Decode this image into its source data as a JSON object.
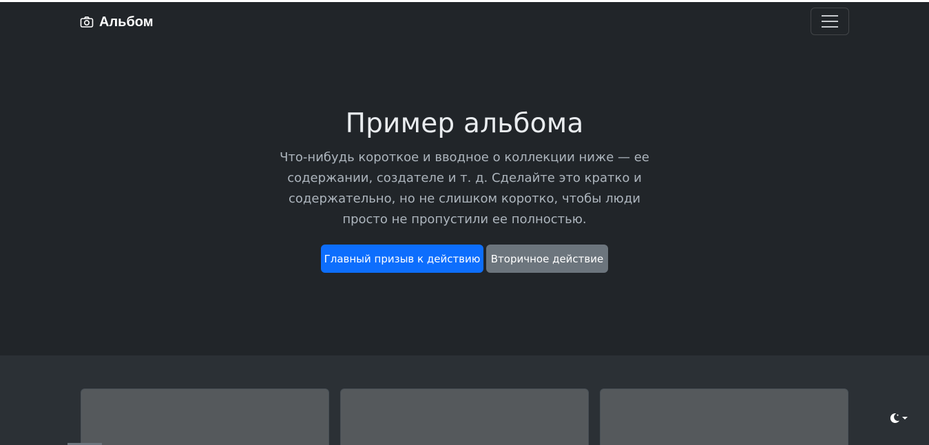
{
  "navbar": {
    "brand_label": "Альбом",
    "brand_icon": "camera-icon",
    "toggler_icon": "hamburger-icon"
  },
  "hero": {
    "title": "Пример альбома",
    "lead": "Что-нибудь короткое и вводное о коллекции ниже — ее содержании, создателе и т. д. Сделайте это кратко и содержательно, но не слишком коротко, чтобы люди просто не пропустили ее полностью.",
    "primary_label": "Главный призыв к действию",
    "secondary_label": "Вторичное действие"
  },
  "theme_toggle": {
    "icon": "moon-icon"
  },
  "colors": {
    "background": "#212529",
    "album_background": "#2b3035",
    "card": "#55595c",
    "primary": "#0d6efd",
    "secondary": "#6c757d"
  }
}
